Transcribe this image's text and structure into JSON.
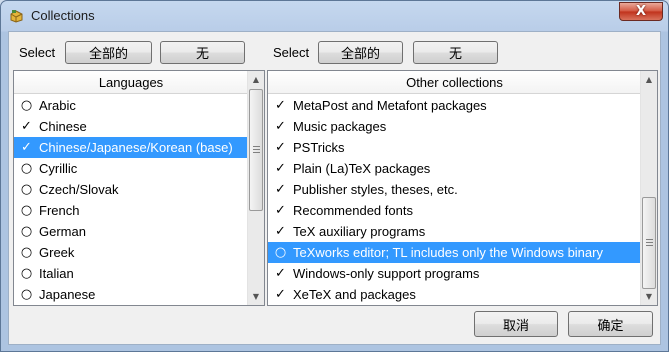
{
  "window": {
    "title": "Collections",
    "close_label": "X"
  },
  "left_panel": {
    "select_label": "Select",
    "all_button": "全部的",
    "none_button": "无",
    "header": "Languages",
    "items": [
      {
        "mark": "○",
        "label": "Arabic"
      },
      {
        "mark": "✓",
        "label": "Chinese"
      },
      {
        "mark": "✓",
        "label": "Chinese/Japanese/Korean (base)",
        "selected": true
      },
      {
        "mark": "○",
        "label": "Cyrillic"
      },
      {
        "mark": "○",
        "label": "Czech/Slovak"
      },
      {
        "mark": "○",
        "label": "French"
      },
      {
        "mark": "○",
        "label": "German"
      },
      {
        "mark": "○",
        "label": "Greek"
      },
      {
        "mark": "○",
        "label": "Italian"
      },
      {
        "mark": "○",
        "label": "Japanese"
      }
    ]
  },
  "right_panel": {
    "select_label": "Select",
    "all_button": "全部的",
    "none_button": "无",
    "header": "Other collections",
    "items": [
      {
        "mark": "✓",
        "label": "MetaPost and Metafont packages"
      },
      {
        "mark": "✓",
        "label": "Music packages"
      },
      {
        "mark": "✓",
        "label": "PSTricks"
      },
      {
        "mark": "✓",
        "label": "Plain (La)TeX packages"
      },
      {
        "mark": "✓",
        "label": "Publisher styles, theses, etc."
      },
      {
        "mark": "✓",
        "label": "Recommended fonts"
      },
      {
        "mark": "✓",
        "label": "TeX auxiliary programs"
      },
      {
        "mark": "○",
        "label": "TeXworks editor; TL includes only the Windows binary",
        "selected": true
      },
      {
        "mark": "✓",
        "label": "Windows-only support programs"
      },
      {
        "mark": "✓",
        "label": "XeTeX and packages"
      }
    ]
  },
  "footer": {
    "cancel_button": "取消",
    "ok_button": "确定"
  },
  "colors": {
    "selection": "#3399ff",
    "frame": "#b9cde8",
    "close": "#c0311b"
  }
}
